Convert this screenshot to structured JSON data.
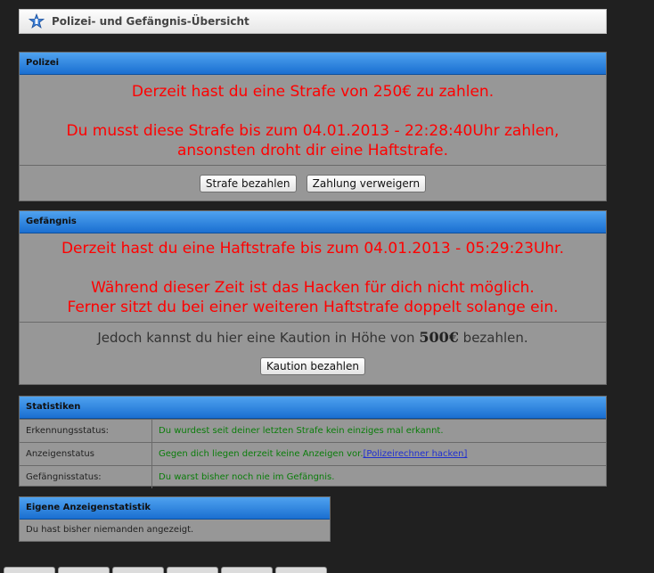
{
  "header": {
    "title": "Polizei- und Gefängnis-Übersicht",
    "icon": "star-badge-icon"
  },
  "police": {
    "heading": "Polizei",
    "line1": "Derzeit hast du eine Strafe von 250€ zu zahlen.",
    "line2": "Du musst diese Strafe bis zum 04.01.2013 - 22:28:40Uhr zahlen,",
    "line3": "ansonsten droht dir eine Haftstrafe.",
    "pay_button": "Strafe bezahlen",
    "refuse_button": "Zahlung verweigern"
  },
  "prison": {
    "heading": "Gefängnis",
    "line1": "Derzeit hast du eine Haftstrafe bis zum 04.01.2013 - 05:29:23Uhr.",
    "line2": "Während dieser Zeit ist das Hacken für dich nicht möglich.",
    "line3": "Ferner sitzt du bei einer weiteren Haftstrafe doppelt solange ein.",
    "bail_text_before": "Jedoch kannst du hier eine Kaution in Höhe von",
    "bail_amount": "500€",
    "bail_text_after": "bezahlen.",
    "bail_button": "Kaution bezahlen"
  },
  "stats": {
    "heading": "Statistiken",
    "rows": [
      {
        "label": "Erkennungsstatus:",
        "value": "Du wurdest seit deiner letzten Strafe kein einziges mal erkannt."
      },
      {
        "label": "Anzeigenstatus",
        "value": "Gegen dich liegen derzeit keine Anzeigen vor.",
        "link": "[Polizeirechner hacken]"
      },
      {
        "label": "Gefängnisstatus:",
        "value": "Du warst bisher noch nie im Gefängnis."
      }
    ]
  },
  "own_stats": {
    "heading": "Eigene Anzeigenstatistik",
    "text": "Du hast bisher niemanden angezeigt."
  },
  "colors": {
    "background": "#202020",
    "panel": "#979797",
    "header_blue": "#1a6fd1",
    "alert_red": "#ff0000",
    "status_green": "#0a7d0a",
    "link_blue": "#1f2fd0"
  }
}
